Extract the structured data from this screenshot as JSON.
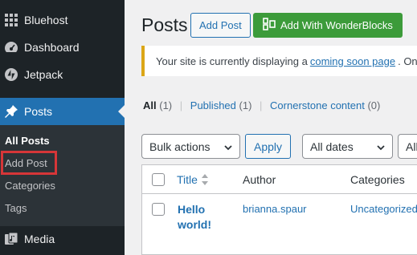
{
  "sidebar": {
    "items": [
      {
        "label": "Bluehost",
        "icon": "grid-icon"
      },
      {
        "label": "Dashboard",
        "icon": "dashboard-icon"
      },
      {
        "label": "Jetpack",
        "icon": "jetpack-icon"
      },
      {
        "label": "Posts",
        "icon": "pin-icon",
        "active": true
      },
      {
        "label": "Media",
        "icon": "media-icon"
      }
    ],
    "submenu": [
      "All Posts",
      "Add Post",
      "Categories",
      "Tags"
    ]
  },
  "header": {
    "title": "Posts",
    "add_post_label": "Add Post",
    "wonderblocks_label": "Add With WonderBlocks"
  },
  "notice": {
    "text_before": "Your site is currently displaying a",
    "link": "coming soon page",
    "text_after": ". Onc"
  },
  "views": {
    "all": "All",
    "all_count": "(1)",
    "published": "Published",
    "published_count": "(1)",
    "cornerstone": "Cornerstone content",
    "cornerstone_count": "(0)"
  },
  "filters": {
    "bulk_actions": "Bulk actions",
    "apply": "Apply",
    "dates": "All dates",
    "categories_partial": "All"
  },
  "table": {
    "columns": [
      "Title",
      "Author",
      "Categories"
    ],
    "rows": [
      {
        "title": "Hello world!",
        "author": "brianna.spaur",
        "category": "Uncategorized"
      }
    ]
  },
  "colors": {
    "sidebar_bg": "#1d2327",
    "active_blue": "#2271b1",
    "green_button": "#3c9b3a",
    "notice_border": "#dba617",
    "highlight_red": "#d63638"
  }
}
